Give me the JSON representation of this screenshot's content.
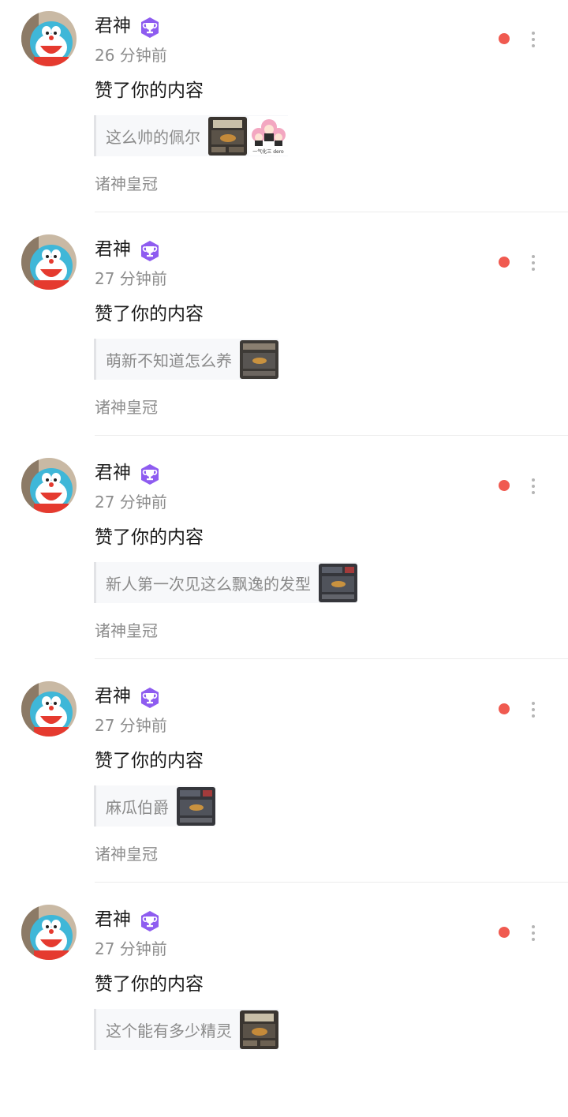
{
  "notifications": [
    {
      "user": "君神",
      "time": "26 分钟前",
      "action": "赞了你的内容",
      "quote": "这么帅的佩尔",
      "sticker": true,
      "source": "诸神皇冠",
      "unread": true
    },
    {
      "user": "君神",
      "time": "27 分钟前",
      "action": "赞了你的内容",
      "quote": "萌新不知道怎么养",
      "sticker": false,
      "source": "诸神皇冠",
      "unread": true
    },
    {
      "user": "君神",
      "time": "27 分钟前",
      "action": "赞了你的内容",
      "quote": "新人第一次见这么飘逸的发型",
      "sticker": false,
      "source": "诸神皇冠",
      "unread": true
    },
    {
      "user": "君神",
      "time": "27 分钟前",
      "action": "赞了你的内容",
      "quote": "麻瓜伯爵",
      "sticker": false,
      "source": "诸神皇冠",
      "unread": true
    },
    {
      "user": "君神",
      "time": "27 分钟前",
      "action": "赞了你的内容",
      "quote": "这个能有多少精灵",
      "sticker": false,
      "source": "",
      "unread": true
    }
  ],
  "sticker_caption": "一气化三 dero",
  "colors": {
    "unread_dot": "#f05a50",
    "badge": "#8e5cf0",
    "avatar_bg": "#3fb7d8"
  },
  "icons": [
    "user-avatar",
    "trophy-badge-icon",
    "unread-dot",
    "more-vertical-icon",
    "post-thumbnail",
    "sticker-image"
  ]
}
